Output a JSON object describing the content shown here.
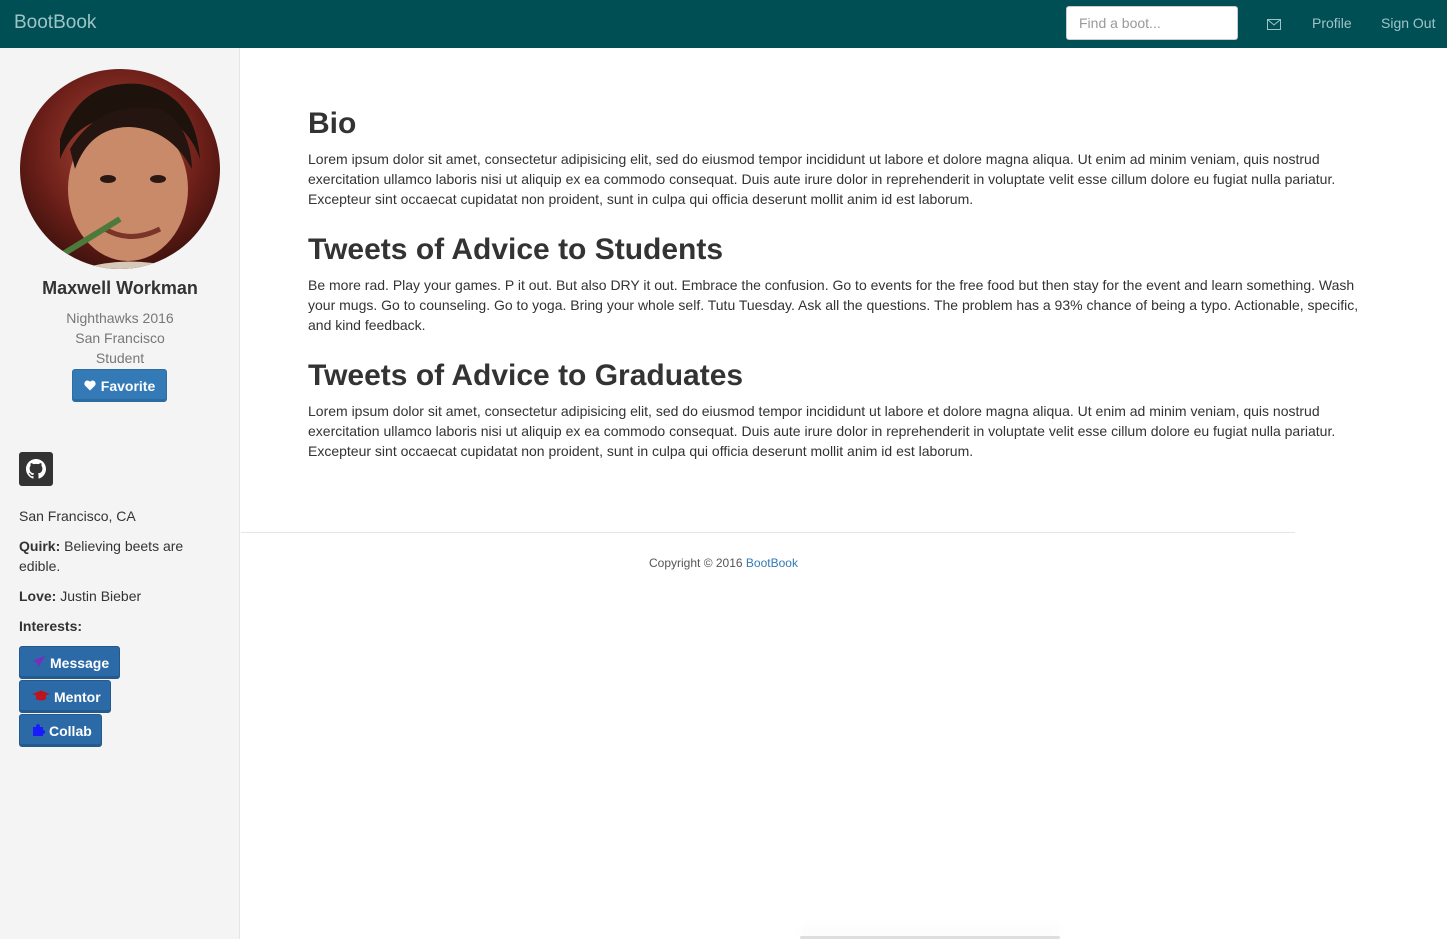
{
  "navbar": {
    "brand": "BootBook",
    "search_placeholder": "Find a boot...",
    "mail_icon": "envelope-icon",
    "profile": "Profile",
    "sign_out": "Sign Out"
  },
  "sidebar": {
    "name": "Maxwell Workman",
    "cohort": "Nighthawks 2016",
    "city": "San Francisco",
    "role": "Student",
    "favorite_label": "Favorite",
    "location": "San Francisco, CA",
    "quirk_label": "Quirk:",
    "quirk_value": "Believing beets are edible.",
    "love_label": "Love:",
    "love_value": "Justin Bieber",
    "interests_label": "Interests:",
    "buttons": [
      {
        "label": "Message",
        "icon": "paper-plane-icon",
        "color": "#7b2cbf"
      },
      {
        "label": "Mentor",
        "icon": "graduation-cap-icon",
        "color": "#c0121a"
      },
      {
        "label": "Collab",
        "icon": "puzzle-icon",
        "color": "#1a1aff"
      }
    ]
  },
  "main": {
    "sections": [
      {
        "title": "Bio",
        "body": "Lorem ipsum dolor sit amet, consectetur adipisicing elit, sed do eiusmod tempor incididunt ut labore et dolore magna aliqua. Ut enim ad minim veniam, quis nostrud exercitation ullamco laboris nisi ut aliquip ex ea commodo consequat. Duis aute irure dolor in reprehenderit in voluptate velit esse cillum dolore eu fugiat nulla pariatur. Excepteur sint occaecat cupidatat non proident, sunt in culpa qui officia deserunt mollit anim id est laborum."
      },
      {
        "title": "Tweets of Advice to Students",
        "body": "Be more rad. Play your games. P it out. But also DRY it out. Embrace the confusion. Go to events for the free food but then stay for the event and learn something. Wash your mugs. Go to counseling. Go to yoga. Bring your whole self. Tutu Tuesday. Ask all the questions. The problem has a 93% chance of being a typo. Actionable, specific, and kind feedback."
      },
      {
        "title": "Tweets of Advice to Graduates",
        "body": "Lorem ipsum dolor sit amet, consectetur adipisicing elit, sed do eiusmod tempor incididunt ut labore et dolore magna aliqua. Ut enim ad minim veniam, quis nostrud exercitation ullamco laboris nisi ut aliquip ex ea commodo consequat. Duis aute irure dolor in reprehenderit in voluptate velit esse cillum dolore eu fugiat nulla pariatur. Excepteur sint occaecat cupidatat non proident, sunt in culpa qui officia deserunt mollit anim id est laborum."
      }
    ]
  },
  "footer": {
    "copyright": "Copyright © 2016",
    "brand_link": "BootBook"
  },
  "colors": {
    "navbar": "#004f55",
    "primary_button": "#337ab7",
    "sidebar_bg": "#f4f4f4"
  }
}
